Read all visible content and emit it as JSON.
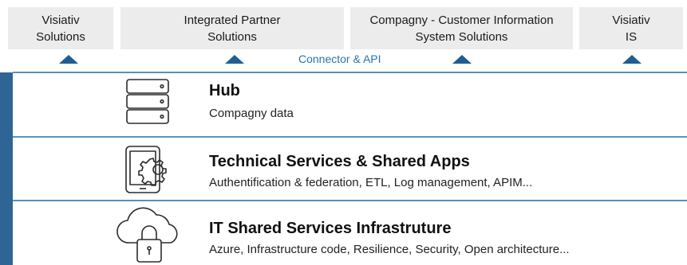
{
  "top_boxes": [
    {
      "label": "Visiativ\nSolutions"
    },
    {
      "label": "Integrated Partner\nSolutions"
    },
    {
      "label": "Compagny - Customer Information\nSystem Solutions"
    },
    {
      "label": "Visiativ\nIS"
    }
  ],
  "connector_label": "Connector & API",
  "layers": [
    {
      "title": "Hub",
      "subtitle": "Compagny data",
      "icon": "server-stack-icon"
    },
    {
      "title": "Technical Services & Shared Apps",
      "subtitle": "Authentification & federation, ETL, Log management, APIM...",
      "icon": "device-gear-icon"
    },
    {
      "title": "IT Shared Services Infrastruture",
      "subtitle": "Azure, Infrastructure code, Resilience, Security, Open architecture...",
      "icon": "cloud-lock-icon"
    }
  ],
  "colors": {
    "accent_blue": "#2f6595",
    "arrow_blue": "#1f5e91",
    "link_blue": "#2d72ad",
    "box_gray": "#ececec",
    "divider_blue": "#5a8fbd"
  }
}
